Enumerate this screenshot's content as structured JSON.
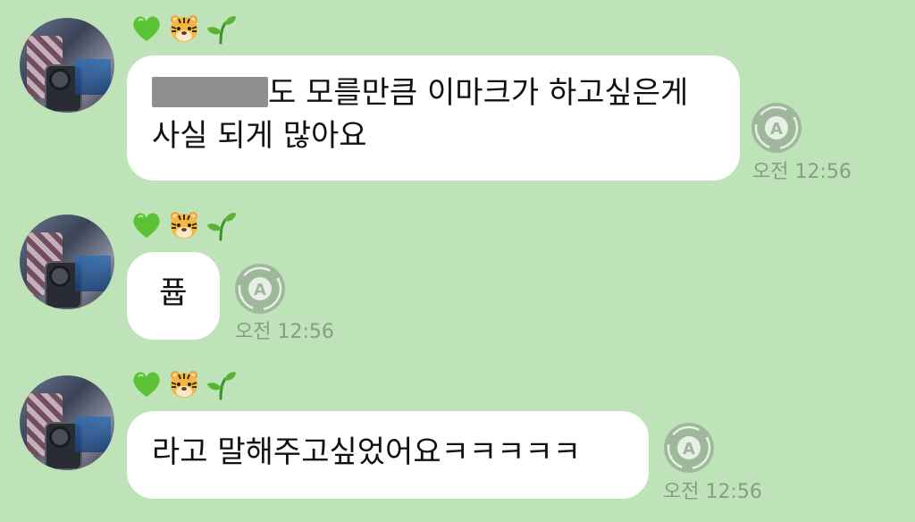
{
  "messages": [
    {
      "emojis": [
        "green-heart",
        "tiger-face",
        "seedling"
      ],
      "text_line1": "도 모를만큼 이마크가 하고싶은게",
      "text_line2": "사실 되게 많아요",
      "time": "오전 12:56"
    },
    {
      "emojis": [
        "green-heart",
        "tiger-face",
        "seedling"
      ],
      "text": "퓹",
      "time": "오전 12:56"
    },
    {
      "emojis": [
        "green-heart",
        "tiger-face",
        "seedling"
      ],
      "text": "라고 말해주고싶었어요ㅋㅋㅋㅋㅋ",
      "time": "오전 12:56"
    }
  ],
  "translate_icon_letter": "A",
  "colors": {
    "background": "#bfe3b9",
    "bubble": "#ffffff",
    "time": "#8a9b87",
    "icon": "#9fb89c"
  }
}
